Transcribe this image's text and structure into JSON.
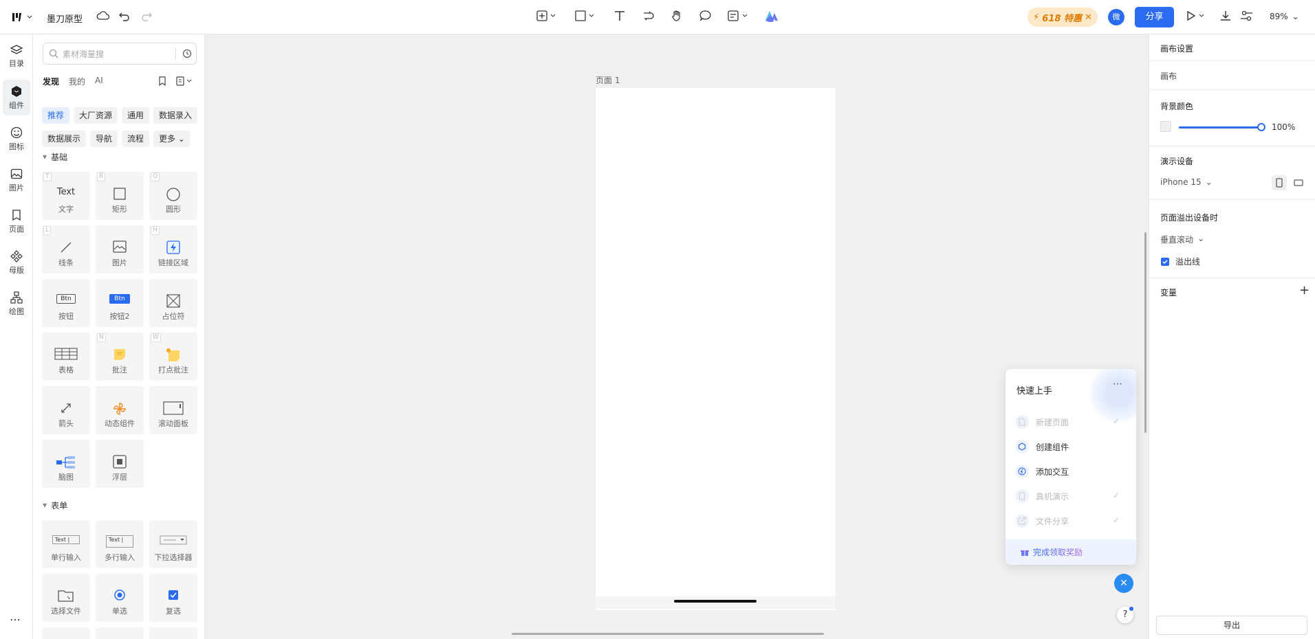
{
  "topbar": {
    "app_title": "墨刀原型",
    "promo_label": "618 特惠",
    "avatar_label": "微",
    "share_label": "分享",
    "zoom_label": "89%"
  },
  "rail": [
    {
      "label": "目录"
    },
    {
      "label": "组件"
    },
    {
      "label": "图标"
    },
    {
      "label": "图片"
    },
    {
      "label": "页面"
    },
    {
      "label": "母版"
    },
    {
      "label": "绘图"
    }
  ],
  "panel": {
    "search_placeholder": "素材海量搜",
    "tabs": [
      "发现",
      "我的",
      "AI"
    ],
    "chips": [
      "推荐",
      "大厂资源",
      "通用",
      "数据录入",
      "数据展示",
      "导航",
      "流程",
      "更多"
    ],
    "section_basic": "基础",
    "section_form": "表单",
    "basic_tiles": [
      {
        "glyph": "Text",
        "label": "文字",
        "key": "T"
      },
      {
        "glyph": "",
        "label": "矩形",
        "key": "R"
      },
      {
        "glyph": "",
        "label": "圆形",
        "key": "O"
      },
      {
        "glyph": "",
        "label": "线条",
        "key": "L"
      },
      {
        "glyph": "",
        "label": "图片",
        "key": ""
      },
      {
        "glyph": "",
        "label": "链接区域",
        "key": "H"
      },
      {
        "glyph": "Btn",
        "label": "按钮",
        "key": ""
      },
      {
        "glyph": "Btn",
        "label": "按钮2",
        "key": ""
      },
      {
        "glyph": "",
        "label": "占位符",
        "key": ""
      },
      {
        "glyph": "",
        "label": "表格",
        "key": ""
      },
      {
        "glyph": "",
        "label": "批注",
        "key": "N"
      },
      {
        "glyph": "",
        "label": "打点批注",
        "key": "W"
      },
      {
        "glyph": "",
        "label": "箭头",
        "key": ""
      },
      {
        "glyph": "",
        "label": "动态组件",
        "key": ""
      },
      {
        "glyph": "",
        "label": "滚动面板",
        "key": ""
      },
      {
        "glyph": "",
        "label": "脑图",
        "key": ""
      },
      {
        "glyph": "",
        "label": "浮层",
        "key": ""
      }
    ],
    "form_tiles": [
      {
        "glyph": "Text |",
        "label": "单行输入"
      },
      {
        "glyph": "Text |",
        "label": "多行输入"
      },
      {
        "glyph": "",
        "label": "下拉选择器"
      },
      {
        "glyph": "",
        "label": "选择文件"
      },
      {
        "glyph": "",
        "label": "单选"
      },
      {
        "glyph": "",
        "label": "复选"
      }
    ]
  },
  "canvas": {
    "page_label": "页面 1"
  },
  "quickstart": {
    "title": "快速上手",
    "items": [
      {
        "label": "新建页面",
        "done": true
      },
      {
        "label": "创建组件",
        "done": false
      },
      {
        "label": "添加交互",
        "done": false
      },
      {
        "label": "真机演示",
        "done": true
      },
      {
        "label": "文件分享",
        "done": true
      }
    ],
    "reward_label": "完成领取奖励"
  },
  "right": {
    "header": "画布设置",
    "canvas_label": "画布",
    "bg_color_title": "背景颜色",
    "opacity_value": "100%",
    "opacity_fraction": 1.0,
    "device_title": "演示设备",
    "device_value": "iPhone 15",
    "overflow_title": "页面溢出设备时",
    "overflow_value": "垂直滚动",
    "overflow_line_label": "溢出线",
    "variables_title": "变量",
    "export_label": "导出"
  },
  "colors": {
    "accent": "#2a6bf2",
    "promo_bg": "#fde9c8",
    "promo_text": "#e07a00"
  }
}
